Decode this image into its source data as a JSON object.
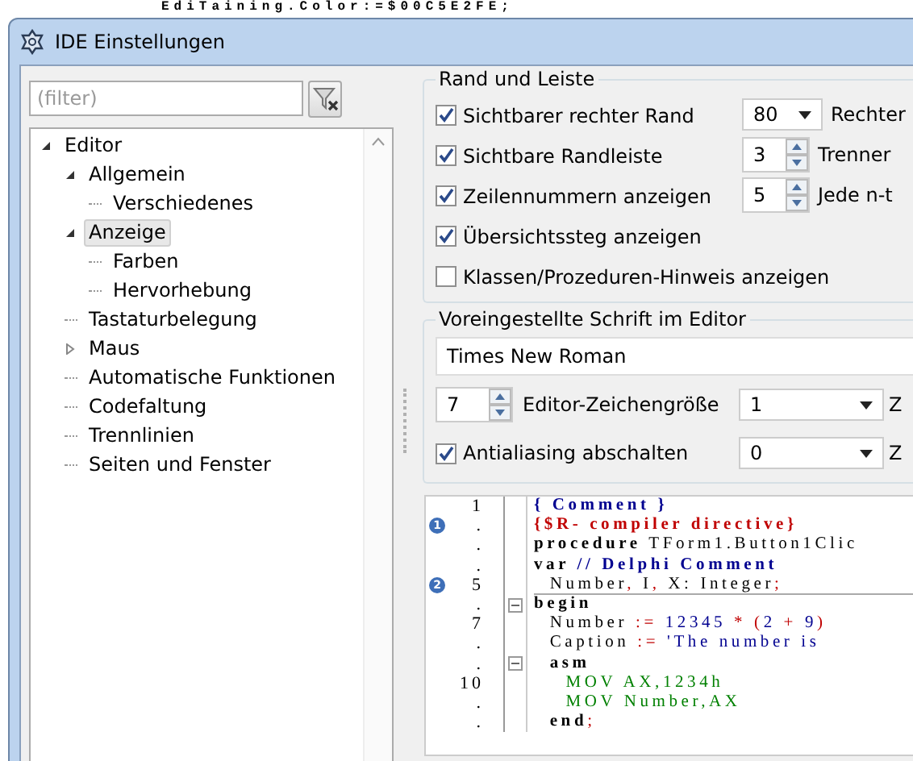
{
  "background_code": "EdiTaining.Color:=$00C5E2FE;",
  "window": {
    "title": "IDE Einstellungen"
  },
  "filter": {
    "placeholder": "(filter)"
  },
  "tree": [
    {
      "label": "Editor",
      "expanded": true,
      "selected": false,
      "children": [
        {
          "label": "Allgemein",
          "expanded": true,
          "selected": false,
          "children": [
            {
              "label": "Verschiedenes",
              "selected": false
            }
          ]
        },
        {
          "label": "Anzeige",
          "expanded": true,
          "selected": true,
          "children": [
            {
              "label": "Farben",
              "selected": false
            },
            {
              "label": "Hervorhebung",
              "selected": false
            }
          ]
        },
        {
          "label": "Tastaturbelegung",
          "selected": false
        },
        {
          "label": "Maus",
          "expanded": false,
          "selected": false
        },
        {
          "label": "Automatische Funktionen",
          "selected": false
        },
        {
          "label": "Codefaltung",
          "selected": false
        },
        {
          "label": "Trennlinien",
          "selected": false
        },
        {
          "label": "Seiten und Fenster",
          "selected": false
        }
      ]
    }
  ],
  "margin_group": {
    "title": "Rand und Leiste",
    "checkboxes": [
      {
        "label": "Sichtbarer rechter Rand",
        "checked": true
      },
      {
        "label": "Sichtbare Randleiste",
        "checked": true
      },
      {
        "label": "Zeilennummern anzeigen",
        "checked": true
      },
      {
        "label": "Übersichtssteg anzeigen",
        "checked": true
      },
      {
        "label": "Klassen/Prozeduren-Hinweis anzeigen",
        "checked": false
      }
    ],
    "controls": [
      {
        "kind": "combo",
        "value": "80",
        "label": "Rechter"
      },
      {
        "kind": "spin",
        "value": "3",
        "label": "Trenner"
      },
      {
        "kind": "spin",
        "value": "5",
        "label": "Jede n-t"
      }
    ]
  },
  "font_group": {
    "title": "Voreingestellte Schrift im Editor",
    "font": "Times New Roman",
    "size": {
      "value": "7",
      "label": "Editor-Zeichengröße"
    },
    "size_combo": {
      "value": "1",
      "label": "Z"
    },
    "antialias": {
      "label": "Antialiasing abschalten",
      "checked": true
    },
    "antialias_combo": {
      "value": "0",
      "label": "Z"
    }
  },
  "preview": [
    {
      "number": "1",
      "tokens": [
        {
          "text": "{ Comment }",
          "kind": "comment"
        }
      ]
    },
    {
      "number": ".",
      "badge": "1",
      "tokens": [
        {
          "text": "{$R- compiler directive}",
          "kind": "directive"
        }
      ]
    },
    {
      "number": ".",
      "tokens": [
        {
          "text": "procedure",
          "kind": "keyword"
        },
        {
          "text": " TForm1.Button1Clic",
          "kind": "normal"
        }
      ]
    },
    {
      "number": ".",
      "tokens": [
        {
          "text": "var",
          "kind": "keyword"
        },
        {
          "text": " // Delphi Comment",
          "kind": "comment"
        }
      ]
    },
    {
      "number": "5",
      "badge": "2",
      "tokens": [
        {
          "text": "  Number",
          "kind": "normal"
        },
        {
          "text": ",",
          "kind": "symbol"
        },
        {
          "text": " I",
          "kind": "normal"
        },
        {
          "text": ",",
          "kind": "symbol"
        },
        {
          "text": " X: Integer",
          "kind": "normal"
        },
        {
          "text": ";",
          "kind": "symbol"
        }
      ]
    },
    {
      "number": ".",
      "fold": true,
      "tokens": [
        {
          "text": "begin",
          "kind": "keyword"
        }
      ]
    },
    {
      "number": "7",
      "tokens": [
        {
          "text": "  Number ",
          "kind": "normal"
        },
        {
          "text": ":= ",
          "kind": "symbol"
        },
        {
          "text": "12345",
          "kind": "number"
        },
        {
          "text": " * (",
          "kind": "symbol"
        },
        {
          "text": "2",
          "kind": "number"
        },
        {
          "text": " + ",
          "kind": "symbol"
        },
        {
          "text": "9",
          "kind": "number"
        },
        {
          "text": ")",
          "kind": "symbol"
        }
      ]
    },
    {
      "number": ".",
      "tokens": [
        {
          "text": "  Caption ",
          "kind": "normal"
        },
        {
          "text": ":= ",
          "kind": "symbol"
        },
        {
          "text": "'The number is",
          "kind": "string"
        }
      ]
    },
    {
      "number": ".",
      "fold": true,
      "tokens": [
        {
          "text": "  asm",
          "kind": "keyword"
        }
      ]
    },
    {
      "number": "10",
      "tokens": [
        {
          "text": "    MOV AX,1234h",
          "kind": "asm"
        }
      ]
    },
    {
      "number": ".",
      "tokens": [
        {
          "text": "    MOV Number,AX",
          "kind": "asm"
        }
      ]
    },
    {
      "number": ".",
      "tokens": [
        {
          "text": "  end",
          "kind": "keyword"
        },
        {
          "text": ";",
          "kind": "symbol"
        }
      ]
    }
  ]
}
